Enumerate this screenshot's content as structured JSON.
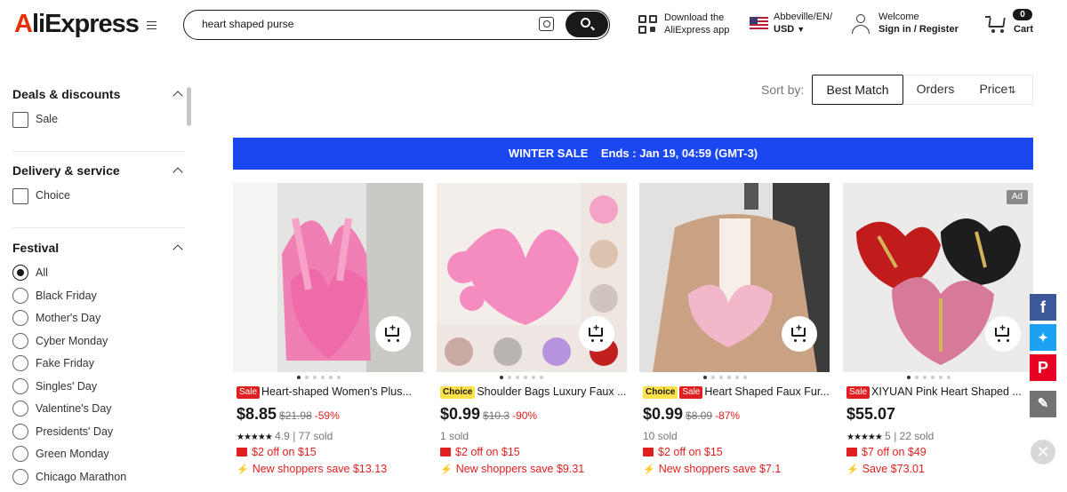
{
  "header": {
    "logo": "AliExpress",
    "search": {
      "value": "heart shaped purse"
    },
    "app_line1": "Download the",
    "app_line2": "AliExpress app",
    "locale_line1": "Abbeville/EN/",
    "locale_line2": "USD",
    "welcome": "Welcome",
    "signin": "Sign in / Register",
    "cart_count": "0",
    "cart_label": "Cart"
  },
  "sidebar": {
    "sections": [
      {
        "title": "Deals & discounts",
        "options": [
          "Sale"
        ]
      },
      {
        "title": "Delivery & service",
        "options": [
          "Choice"
        ]
      },
      {
        "title": "Festival",
        "options": [
          "All",
          "Black Friday",
          "Mother's Day",
          "Cyber Monday",
          "Fake Friday",
          "Singles' Day",
          "Valentine's Day",
          "Presidents' Day",
          "Green Monday",
          "Chicago Marathon"
        ],
        "selected": "All"
      }
    ]
  },
  "sort": {
    "label": "Sort by:",
    "options": [
      "Best Match",
      "Orders",
      "Price"
    ],
    "active": "Best Match"
  },
  "banner": {
    "title": "WINTER SALE",
    "text": "Ends :  Jan 19, 04:59 (GMT-3)"
  },
  "products": [
    {
      "tags": [
        "Sale"
      ],
      "title": "Heart-shaped Women's Plus...",
      "price": "$8.85",
      "old_price": "$21.98",
      "discount": "-59%",
      "rating": "4.9",
      "sold": "77 sold",
      "promo1": "$2 off on $15",
      "promo2": "New shoppers save $13.13",
      "ad": ""
    },
    {
      "tags": [
        "Choice"
      ],
      "title": "Shoulder Bags Luxury Faux ...",
      "price": "$0.99",
      "old_price": "$10.3",
      "discount": "-90%",
      "rating": "",
      "sold": "1 sold",
      "promo1": "$2 off on $15",
      "promo2": "New shoppers save $9.31",
      "ad": ""
    },
    {
      "tags": [
        "Choice",
        "Sale"
      ],
      "title": "Heart Shaped Faux Fur...",
      "price": "$0.99",
      "old_price": "$8.09",
      "discount": "-87%",
      "rating": "",
      "sold": "10 sold",
      "promo1": "$2 off on $15",
      "promo2": "New shoppers save $7.1",
      "ad": ""
    },
    {
      "tags": [
        "Sale"
      ],
      "title": "XIYUAN Pink Heart Shaped ...",
      "price": "$55.07",
      "old_price": "",
      "discount": "",
      "rating": "5",
      "sold": "22 sold",
      "promo1": "$7 off on $49",
      "promo2": "Save $73.01",
      "ad": "Ad"
    }
  ],
  "social": [
    "facebook-icon",
    "twitter-icon",
    "pinterest-icon",
    "edit-icon"
  ],
  "colors": {
    "brand_red": "#e62e04",
    "banner_blue": "#1a47f0",
    "sale_red": "#e02020",
    "choice_yellow": "#ffe249"
  }
}
